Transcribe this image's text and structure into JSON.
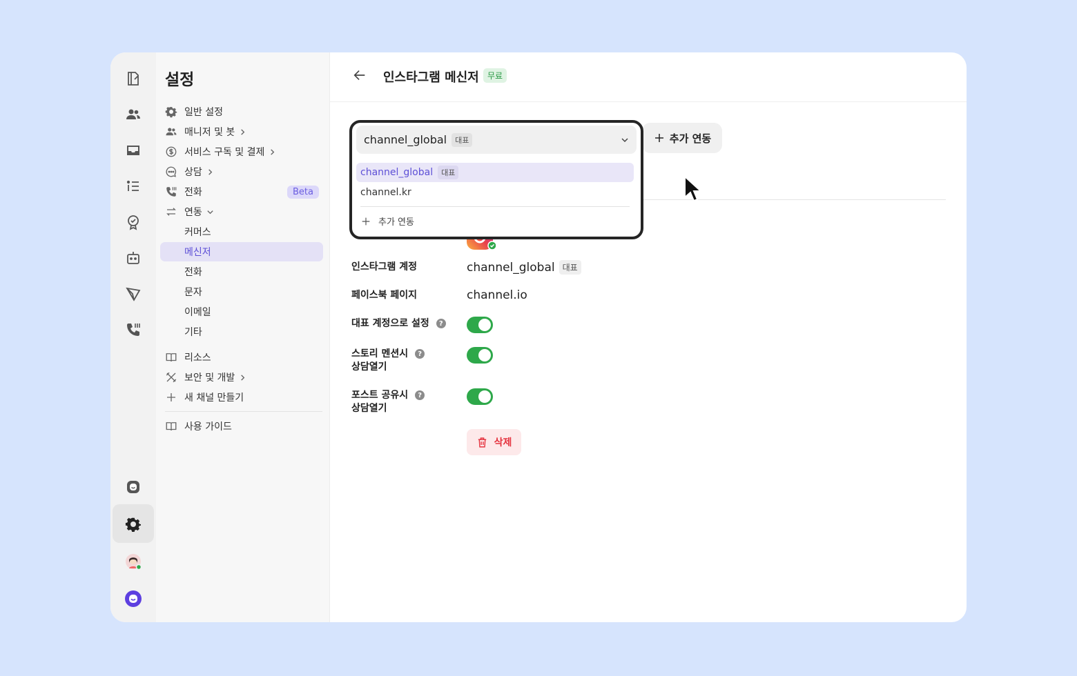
{
  "sidebar": {
    "title": "설정",
    "items": [
      {
        "label": "일반 설정"
      },
      {
        "label": "매니저 및 봇"
      },
      {
        "label": "서비스 구독 및 결제"
      },
      {
        "label": "상담"
      },
      {
        "label": "전화",
        "badge": "Beta"
      },
      {
        "label": "연동"
      },
      {
        "label": "커머스"
      },
      {
        "label": "메신저"
      },
      {
        "label": "전화"
      },
      {
        "label": "문자"
      },
      {
        "label": "이메일"
      },
      {
        "label": "기타"
      },
      {
        "label": "리소스"
      },
      {
        "label": "보안 및 개발"
      },
      {
        "label": "새 채널 만들기"
      },
      {
        "label": "사용 가이드"
      }
    ]
  },
  "header": {
    "title": "인스타그램 메신저",
    "badge": "무료"
  },
  "account_select": {
    "selected_value": "channel_global",
    "selected_tag": "대표",
    "options": [
      {
        "label": "channel_global",
        "tag": "대표"
      },
      {
        "label": "channel.kr"
      }
    ],
    "add_option_label": "추가 연동"
  },
  "add_button_label": "추가 연동",
  "details": {
    "instagram_account": {
      "label": "인스타그램 계정",
      "value": "channel_global",
      "tag": "대표"
    },
    "facebook_page": {
      "label": "페이스북 페이지",
      "value": "channel.io"
    },
    "set_primary": {
      "label": "대표 계정으로 설정",
      "enabled": true
    },
    "story_mention": {
      "label_line1": "스토리 멘션시",
      "label_line2": "상담열기",
      "enabled": true
    },
    "post_share": {
      "label_line1": "포스트 공유시",
      "label_line2": "상담열기",
      "enabled": true
    },
    "delete_label": "삭제"
  },
  "colors": {
    "accent": "#5d4fd6",
    "toggle_on": "#2ea84a",
    "danger": "#e5333f",
    "background": "#d6e4fd"
  }
}
